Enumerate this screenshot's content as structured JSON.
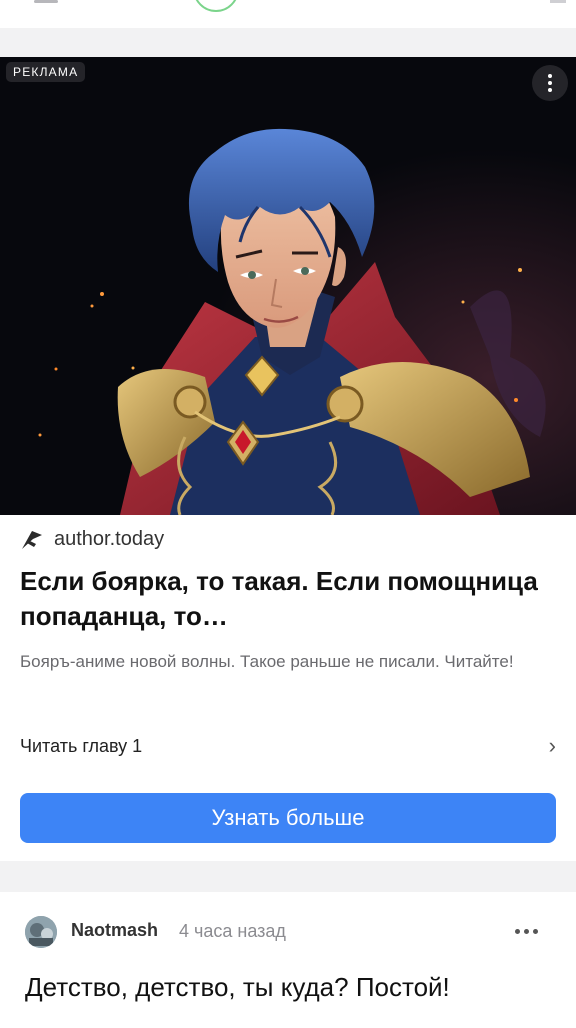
{
  "ad": {
    "badge": "РЕКЛАМА",
    "source": "author.today",
    "title": "Если боярка, то такая. Если помощница попаданца, то…",
    "description": "Бояръ-аниме новой волны. Такое раньше не писали. Читайте!",
    "read_link": "Читать главу 1",
    "cta": "Узнать больше",
    "image_description": "Anime-style illustration of a blue-haired nobleman in a navy uniform with gold embroidery, a red-lined high-collar cloak and golden shoulder armor, on a dark background with glowing embers",
    "menu_icon": "more-vertical-icon",
    "source_icon": "author-today-logo-icon",
    "chevron_icon": "chevron-right-icon"
  },
  "post": {
    "author": "Naotmash",
    "time": "4 часа назад",
    "title": "Детство, детство, ты куда? Постой!",
    "menu_icon": "more-horizontal-icon"
  },
  "colors": {
    "cta": "#3d84f6",
    "page_bg": "#f2f2f3",
    "card_bg": "#ffffff"
  }
}
